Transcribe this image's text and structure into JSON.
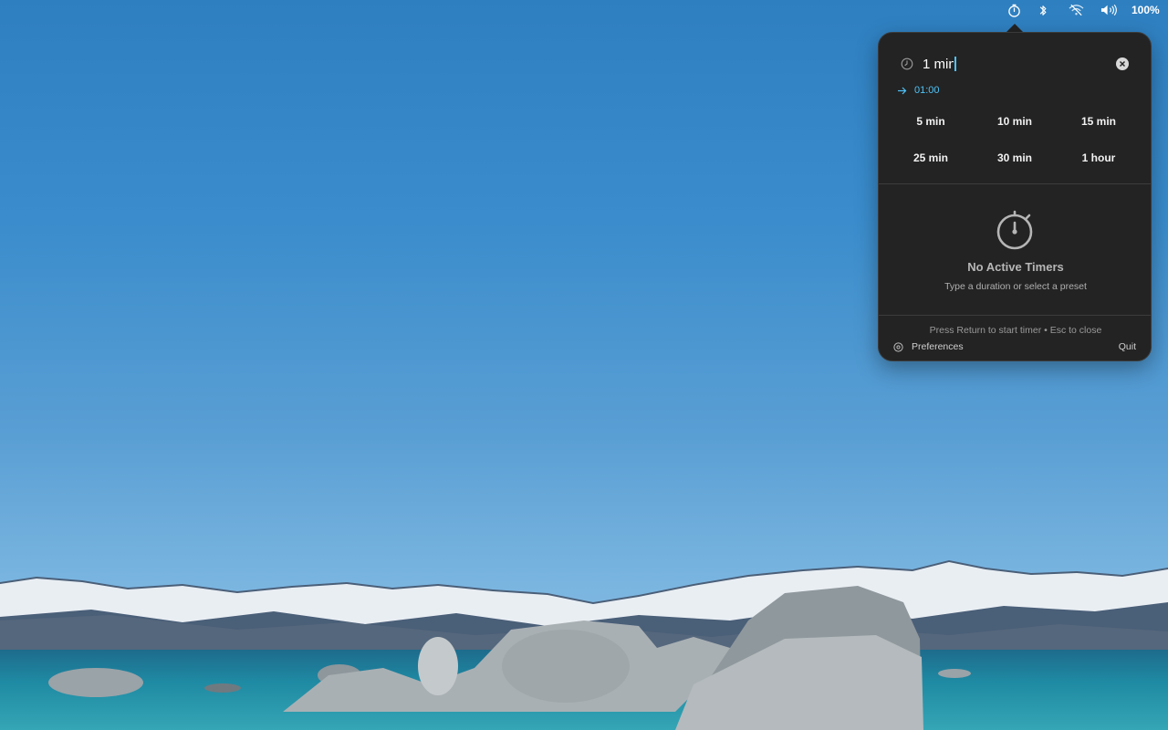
{
  "menubar": {
    "battery_text": "100%",
    "icons": [
      "timer-icon",
      "bluetooth-icon",
      "wifi-off-icon",
      "volume-icon",
      "battery-icon"
    ]
  },
  "popover": {
    "input_value": "1 min",
    "preview_time": "01:00",
    "presets": [
      "5 min",
      "10 min",
      "15 min",
      "25 min",
      "30 min",
      "1 hour"
    ],
    "empty_title": "No Active Timers",
    "empty_subtitle": "Type a duration or select a preset",
    "footer_hint": "Press Return to start timer • Esc to close",
    "preferences_label": "Preferences",
    "quit_label": "Quit"
  },
  "colors": {
    "accent": "#4fc3f7",
    "panel_bg": "#232323"
  }
}
